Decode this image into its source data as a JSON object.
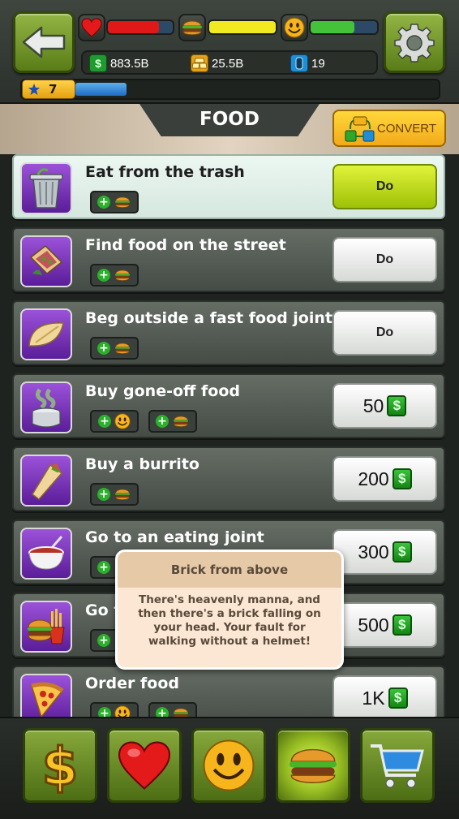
{
  "header": {
    "stats": {
      "health": {
        "icon": "heart-icon",
        "level": 0.79,
        "color": "#e01818"
      },
      "food": {
        "icon": "burger-icon",
        "level": 1.0,
        "color": "#f2ea20"
      },
      "mood": {
        "icon": "smiley-icon",
        "level": 0.66,
        "color": "#44c23a"
      }
    },
    "resources": {
      "money": {
        "icon": "dollar-icon",
        "value": "883.5B"
      },
      "gold": {
        "icon": "gold-bars-icon",
        "value": "25.5B"
      },
      "tokens": {
        "icon": "token-icon",
        "value": "19"
      }
    },
    "level": {
      "icon": "star-icon",
      "value": "7",
      "progress": 0.14
    }
  },
  "title": "FOOD",
  "convert_label": "CONVERT",
  "items": [
    {
      "label": "Eat from the trash",
      "icon": "trash-can-icon",
      "rewards": [
        "burger"
      ],
      "action": "Do",
      "price": null,
      "active": true
    },
    {
      "label": "Find food on the street",
      "icon": "sandwich-icon",
      "rewards": [
        "burger"
      ],
      "action": "Do",
      "price": null,
      "active": false
    },
    {
      "label": "Beg outside a fast food joint",
      "icon": "pasty-icon",
      "rewards": [
        "burger"
      ],
      "action": "Do",
      "price": null,
      "active": false
    },
    {
      "label": "Buy gone-off food",
      "icon": "rotten-can-icon",
      "rewards": [
        "smiley",
        "burger"
      ],
      "action": null,
      "price": "50",
      "active": false
    },
    {
      "label": "Buy a burrito",
      "icon": "burrito-icon",
      "rewards": [
        "burger"
      ],
      "action": null,
      "price": "200",
      "active": false
    },
    {
      "label": "Go to an eating joint",
      "icon": "soup-bowl-icon",
      "rewards": [
        "burger"
      ],
      "action": null,
      "price": "300",
      "active": false
    },
    {
      "label": "Go t",
      "icon": "burger-fries-icon",
      "rewards": [
        "burger"
      ],
      "action": null,
      "price": "500",
      "active": false
    },
    {
      "label": "Order food",
      "icon": "pizza-slice-icon",
      "rewards": [
        "smiley",
        "burger"
      ],
      "action": null,
      "price": "1K",
      "active": false
    }
  ],
  "popup": {
    "title": "Brick from above",
    "text": "There's heavenly manna, and then there's a brick falling on your head. Your fault for walking without a helmet!"
  },
  "nav": [
    {
      "name": "money",
      "icon": "dollar-sign-icon",
      "selected": false
    },
    {
      "name": "health",
      "icon": "heart-icon",
      "selected": false
    },
    {
      "name": "mood",
      "icon": "smiley-icon",
      "selected": false
    },
    {
      "name": "food",
      "icon": "burger-icon",
      "selected": true
    },
    {
      "name": "shop",
      "icon": "shopping-cart-icon",
      "selected": false
    }
  ],
  "colors": {
    "accent_green": "#7aa12c",
    "active_button": "#c6df1d",
    "popup_bg": "#fbe7d3",
    "convert_bg": "#f8c62a"
  }
}
